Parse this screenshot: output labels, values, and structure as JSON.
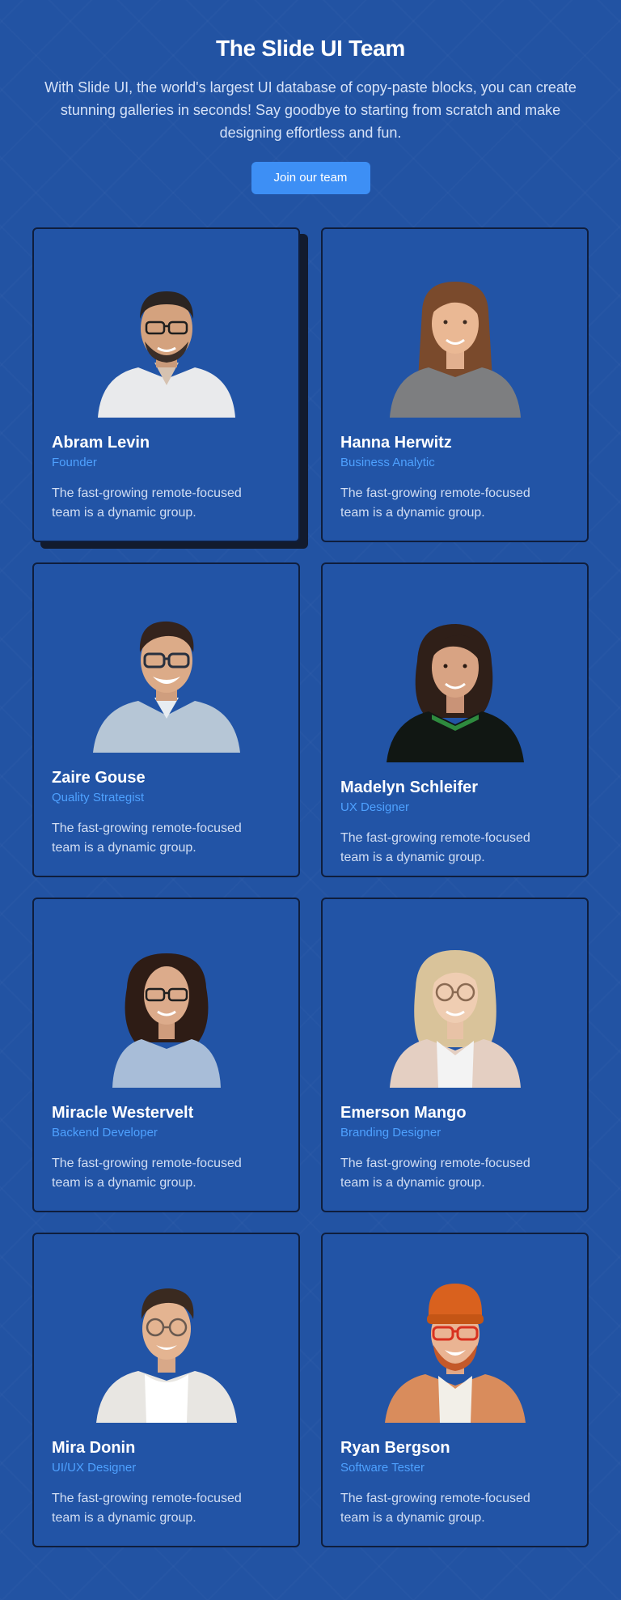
{
  "header": {
    "title": "The Slide UI Team",
    "subtitle": "With Slide UI, the world's largest UI database of copy-paste blocks, you can create stunning galleries in seconds! Say goodbye to starting from scratch and make designing effortless and fun.",
    "cta_label": "Join our team"
  },
  "colors": {
    "background": "#2253a3",
    "card_border": "#0f1e3d",
    "accent": "#3d8ff5",
    "role_text": "#4ea1ff"
  },
  "team": [
    {
      "name": "Abram Levin",
      "role": "Founder",
      "bio": "The fast-growing remote-focused team is a dynamic group.",
      "photo_icon": "portrait-man-glasses-white-shirt"
    },
    {
      "name": "Hanna Herwitz",
      "role": "Business Analytic",
      "bio": "The fast-growing remote-focused team is a dynamic group.",
      "photo_icon": "portrait-woman-long-hair-gray-shirt"
    },
    {
      "name": "Zaire Gouse",
      "role": "Quality Strategist",
      "bio": "The fast-growing remote-focused team is a dynamic group.",
      "photo_icon": "portrait-man-glasses-blue-shirt"
    },
    {
      "name": "Madelyn Schleifer",
      "role": "UX Designer",
      "bio": "The fast-growing remote-focused team is a dynamic group.",
      "photo_icon": "portrait-woman-dark-hair-black-polo"
    },
    {
      "name": "Miracle Westervelt",
      "role": "Backend Developer",
      "bio": "The fast-growing remote-focused team is a dynamic group.",
      "photo_icon": "portrait-woman-glasses-curly-hair"
    },
    {
      "name": "Emerson Mango",
      "role": "Branding Designer",
      "bio": "The fast-growing remote-focused team is a dynamic group.",
      "photo_icon": "portrait-woman-blonde-glasses"
    },
    {
      "name": "Mira Donin",
      "role": "UI/UX Designer",
      "bio": "The fast-growing remote-focused team is a dynamic group.",
      "photo_icon": "portrait-man-glasses-white-sweater"
    },
    {
      "name": "Ryan Bergson",
      "role": "Software Tester",
      "bio": "The fast-growing remote-focused team is a dynamic group.",
      "photo_icon": "portrait-man-orange-beanie-beard"
    }
  ]
}
